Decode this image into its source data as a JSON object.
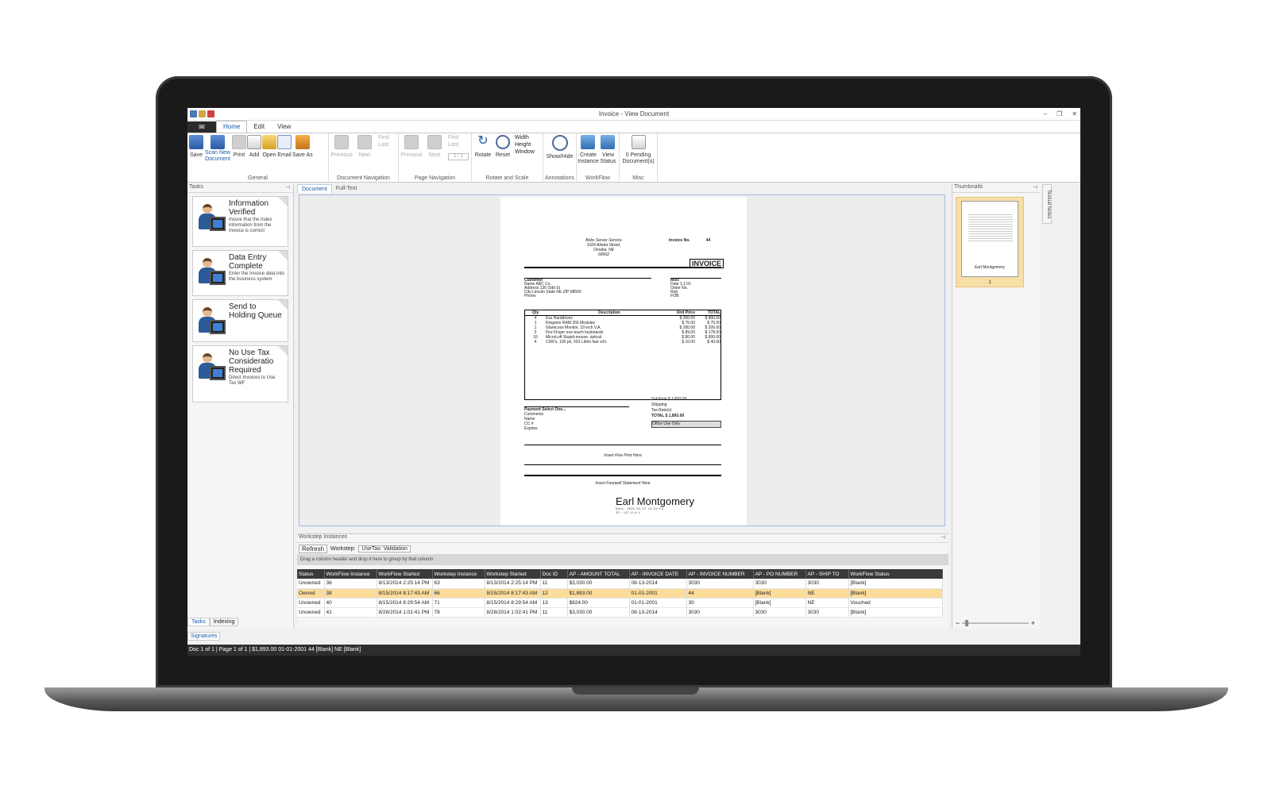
{
  "window": {
    "title": "Invoice - View Document",
    "controls": [
      "–",
      "❐",
      "✕"
    ]
  },
  "menu": {
    "app": "✉",
    "tabs": [
      "Home",
      "Edit",
      "View"
    ]
  },
  "ribbon": {
    "general": {
      "label": "General",
      "buttons": [
        "Save",
        "Scan New Document",
        "Print",
        "Add",
        "Open",
        "Email",
        "Save As"
      ]
    },
    "doc_nav": {
      "label": "Document Navigation",
      "buttons": [
        "Previous",
        "Next"
      ],
      "first": "First",
      "last": "Last"
    },
    "page_nav": {
      "label": "Page Navigation",
      "buttons": [
        "Previous",
        "Next"
      ],
      "first": "First",
      "last": "Last",
      "page": "1 / 1"
    },
    "rotate": {
      "label": "Rotate and Scale",
      "buttons": [
        "Rotate",
        "Reset"
      ],
      "fit": [
        "Width",
        "Height",
        "Window"
      ]
    },
    "annotations": {
      "label": "Annotations",
      "button": "Show/Hide"
    },
    "workflow": {
      "label": "WorkFlow",
      "buttons": [
        "Create Instance",
        "View Status"
      ]
    },
    "misc": {
      "label": "Misc",
      "button": "0 Pending Document(s)"
    }
  },
  "tasks": {
    "header": "Tasks",
    "items": [
      {
        "title": "Information Verified",
        "desc": "Insure that the index information from the Invoice is correct"
      },
      {
        "title": "Data Entry Complete",
        "desc": "Enter the Invoice data into the business system"
      },
      {
        "title": "Send to Holding Queue",
        "desc": ""
      },
      {
        "title": "No Use Tax Consideratio Required",
        "desc": "Direct Invoices to Use Tax WF"
      }
    ],
    "tabs": [
      "Tasks",
      "Indexing"
    ]
  },
  "document": {
    "tabs": [
      "Document",
      "Full-Text"
    ],
    "invoice": {
      "from": "Bobs Server Service\n1024 Abeita Street,\nOmaha, NE\n68502",
      "number_label": "Invoice No.",
      "number": "44",
      "title": "INVOICE",
      "customer": [
        "Customer",
        "Name   ABC Co.",
        "Address   135 Odd St",
        "City   Lincoln   State NE   ZIP 68500",
        "Phone"
      ],
      "misc": [
        "Misc",
        "Date   1.1.01",
        "Order No.",
        "Rep",
        "FOB"
      ],
      "table_header": [
        "Qty",
        "Description",
        "Unit Price",
        "TOTAL"
      ],
      "rows": [
        [
          "4",
          "Ess Harddrives",
          "$ 200.00",
          "$ 800.00"
        ],
        [
          "1",
          "Kingston RAM 256 Modules",
          "$ 75.00",
          "$ 75.00"
        ],
        [
          "1",
          "GlareLess Monitor, 19 inch V.A.",
          "$ 200.00",
          "$ 200.00"
        ],
        [
          "2",
          "Fire Finger noe-touch keyboards",
          "$ 89.00",
          "$ 178.00"
        ],
        [
          "10",
          "MicroLoft Stupid-mouse, optical.",
          "$ 80.00",
          "$ 800.00"
        ],
        [
          "4",
          "CDR's, 100 pk, 32X Lithin fast cd's",
          "$ 10.00",
          "$ 40.00"
        ]
      ],
      "totals": [
        "SubTotal   $ 1,893.00",
        "Shipping",
        "Tax Rate(s)",
        "TOTAL   $ 1,893.00"
      ],
      "payment": [
        "Payment   Select One...",
        "Comments",
        "Name",
        "CC #",
        "Expires"
      ],
      "office": "Office Use Only",
      "fine_print": "Insert Fine Print Here",
      "farewell": "Insert Farewell Statement Here"
    },
    "signature": {
      "name": "Earl Montgomery",
      "date": "Date: 2015-01-27 14:54:54",
      "ip": "IP: 127.0.0.1"
    }
  },
  "thumbnails": {
    "header": "Thumbnails",
    "page": "1",
    "signer": "Earl Montgomery",
    "side_tab": "Textual Notes"
  },
  "workstep": {
    "header": "Workstep Instances",
    "refresh": "Refresh",
    "workstep_label": "Workstep:",
    "workstep_value": "UseTax: Validation",
    "group_hint": "Drag a column header and drop it here to group by that column",
    "columns": [
      "Status",
      "WorkFlow Instance",
      "WorkFlow Started",
      "Workstep Instance",
      "Workstep Started",
      "Doc ID",
      "AP - AMOUNT TOTAL",
      "AP - INVOICE DATE",
      "AP - INVOICE NUMBER",
      "AP - PO NUMBER",
      "AP - SHIP TO",
      "WorkFlow Status"
    ],
    "rows": [
      [
        "Unowned",
        "36",
        "8/13/2014 2:25:14 PM",
        "63",
        "8/13/2014 2:25:14 PM",
        "11",
        "$3,030.00",
        "08-13-2014",
        "3030",
        "3030",
        "3030",
        "[Blank]"
      ],
      [
        "Owned",
        "38",
        "8/15/2014 8:17:43 AM",
        "66",
        "8/15/2014 8:17:43 AM",
        "12",
        "$1,893.00",
        "01-01-2001",
        "44",
        "[Blank]",
        "NE",
        "[Blank]"
      ],
      [
        "Unowned",
        "40",
        "8/15/2014 8:29:54 AM",
        "71",
        "8/15/2014 8:29:54 AM",
        "13",
        "$824.00",
        "01-01-2001",
        "30",
        "[Blank]",
        "NE",
        "Vouched"
      ],
      [
        "Unowned",
        "41",
        "8/28/2014 1:02:41 PM",
        "78",
        "8/28/2014 1:02:41 PM",
        "11",
        "$3,030.00",
        "08-13-2014",
        "3030",
        "3030",
        "3030",
        "[Blank]"
      ]
    ]
  },
  "signatures_tab": "Signatures",
  "status": "Doc 1 of 1  |  Page 1 of 1  |  $1,893.00  01-01-2001  44  [Blank]  NE  [Blank]"
}
